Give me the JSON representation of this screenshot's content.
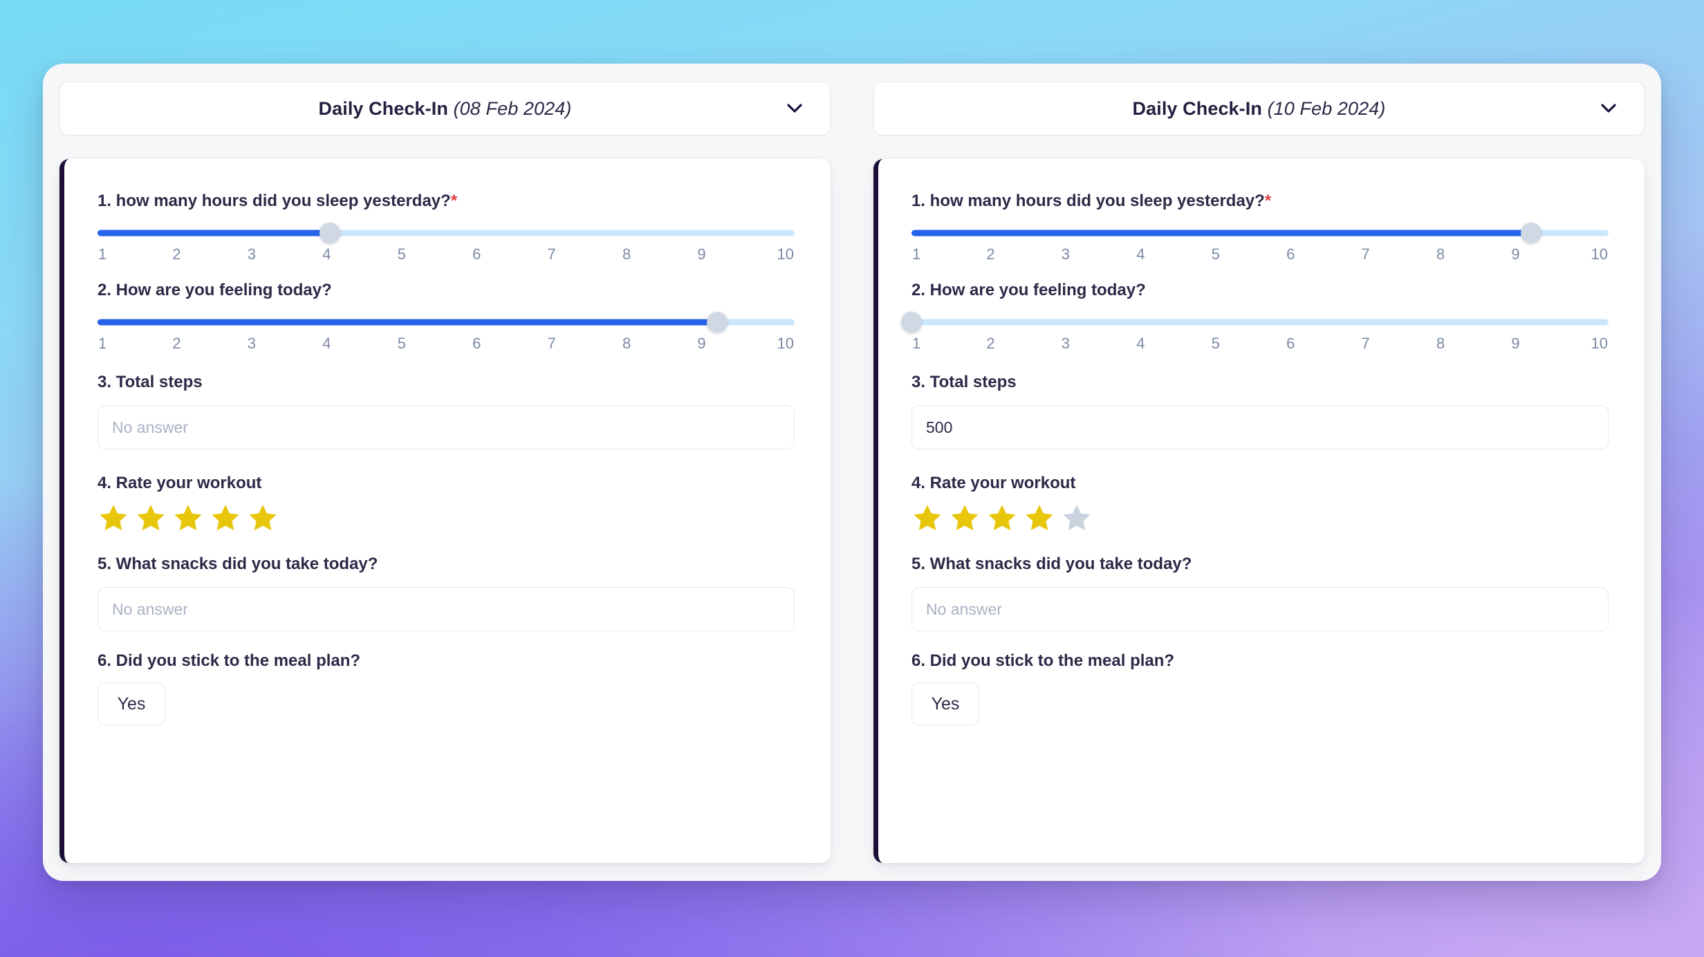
{
  "background": {
    "gradient_top_left": "#76dcf4",
    "gradient_bottom_left": "#7b5ce8",
    "gradient_bottom_right": "#c9a9f2"
  },
  "theme": {
    "accent_blue": "#2563eb",
    "track_empty": "#cce7fb",
    "thumb": "#cfd8e3",
    "card_accent_bar": "#1c1038",
    "star_filled": "#e8c60c",
    "star_empty": "#c8d3de",
    "required_red": "#e0403e",
    "text_dark": "#2b2a47",
    "tick_gray": "#7c8aa5",
    "placeholder_gray": "#a9b1c2"
  },
  "icons": {
    "chevron_down": "chevron-down-icon",
    "star": "star-icon"
  },
  "slider": {
    "ticks": [
      "1",
      "2",
      "3",
      "4",
      "5",
      "6",
      "7",
      "8",
      "9",
      "10"
    ],
    "min": 1,
    "max": 10
  },
  "columns": [
    {
      "header": {
        "title": "Daily Check-In",
        "date": "(08 Feb 2024)"
      },
      "questions": [
        {
          "label": "1. how many hours did you sleep yesterday?",
          "required": true,
          "required_mark": "*",
          "type": "slider",
          "value": 4
        },
        {
          "label": "2. How are you feeling today?",
          "required": false,
          "type": "slider",
          "value": 9
        },
        {
          "label": "3. Total steps",
          "required": false,
          "type": "text",
          "value": "",
          "placeholder": "No answer"
        },
        {
          "label": "4. Rate your workout",
          "required": false,
          "type": "stars",
          "value": 5,
          "max": 5
        },
        {
          "label": "5. What snacks did you take today?",
          "required": false,
          "type": "text",
          "value": "",
          "placeholder": "No answer"
        },
        {
          "label": "6. Did you stick to the meal plan?",
          "required": false,
          "type": "choice",
          "value": "Yes"
        }
      ]
    },
    {
      "header": {
        "title": "Daily Check-In",
        "date": "(10 Feb 2024)"
      },
      "questions": [
        {
          "label": "1. how many hours did you sleep yesterday?",
          "required": true,
          "required_mark": "*",
          "type": "slider",
          "value": 9
        },
        {
          "label": "2. How are you feeling today?",
          "required": false,
          "type": "slider",
          "value": 1
        },
        {
          "label": "3. Total steps",
          "required": false,
          "type": "text",
          "value": "500",
          "placeholder": "No answer"
        },
        {
          "label": "4. Rate your workout",
          "required": false,
          "type": "stars",
          "value": 4,
          "max": 5
        },
        {
          "label": "5. What snacks did you take today?",
          "required": false,
          "type": "text",
          "value": "",
          "placeholder": "No answer"
        },
        {
          "label": "6. Did you stick to the meal plan?",
          "required": false,
          "type": "choice",
          "value": "Yes"
        }
      ]
    }
  ]
}
